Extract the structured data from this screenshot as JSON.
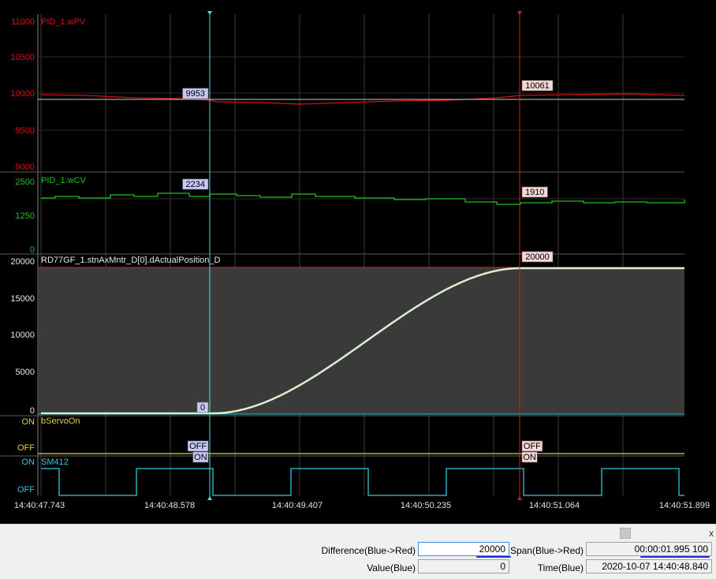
{
  "panels": [
    {
      "key": "pv",
      "name": "PID_1.wPV",
      "color": "#d81010",
      "axis_labels": [
        "11000",
        "10500",
        "10000",
        "9500",
        "9000"
      ],
      "cursor_blue_value": "9953",
      "cursor_red_value": "10061"
    },
    {
      "key": "cv",
      "name": "PID_1.wCV",
      "color": "#1fbf1f",
      "axis_labels": [
        "2500",
        "1250",
        "0"
      ],
      "cursor_blue_value": "2234",
      "cursor_red_value": "1910"
    },
    {
      "key": "pos",
      "name": "RD77GF_1.stnAxMntr_D[0].dActualPosition_D",
      "color": "#e8e8e8",
      "axis_labels": [
        "20000",
        "15000",
        "10000",
        "5000",
        "0"
      ],
      "cursor_blue_value": "0",
      "cursor_red_value": "20000"
    },
    {
      "key": "servo",
      "name": "bServoOn",
      "color": "#e0d040",
      "axis_labels": [
        "ON",
        "OFF"
      ],
      "cursor_blue_value": "OFF",
      "cursor_red_value": "OFF"
    },
    {
      "key": "sm",
      "name": "SM412",
      "color": "#30c8d8",
      "axis_labels": [
        "ON",
        "OFF"
      ],
      "cursor_blue_value": "ON",
      "cursor_red_value": "ON"
    }
  ],
  "time_axis": [
    "14:40:47.743",
    "14:40:48.578",
    "14:40:49.407",
    "14:40:50.235",
    "14:40:51.064",
    "14:40:51.899"
  ],
  "cursors": {
    "blue_color": "#40e0e0",
    "red_color": "#e01818"
  },
  "footer": {
    "difference_label": "Difference(Blue->Red)",
    "difference_value": "20000",
    "span_label": "Span(Blue->Red)",
    "span_value": "00:00:01.995 100",
    "value_label": "Value(Blue)",
    "value_value": "0",
    "time_label": "Time(Blue)",
    "time_value": "2020-10-07 14:40:48.840",
    "close_glyph": "x"
  }
}
